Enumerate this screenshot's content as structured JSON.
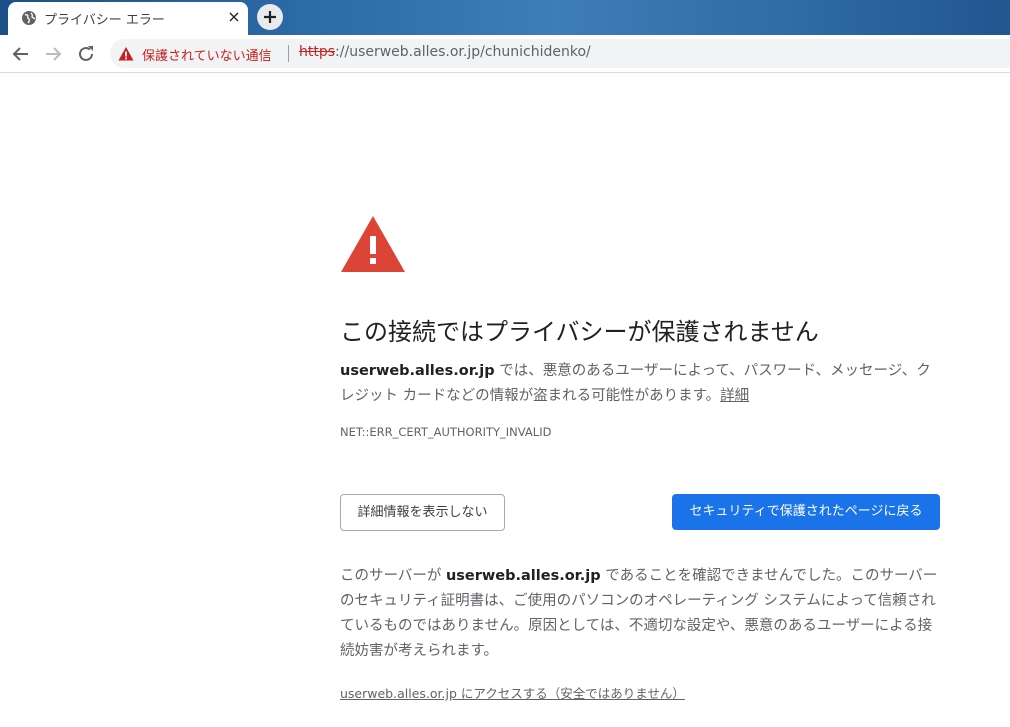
{
  "tab": {
    "title": "プライバシー エラー",
    "close_glyph": "×",
    "icon": "globe-icon"
  },
  "toolbar": {
    "back_icon": "back-arrow-icon",
    "forward_icon": "forward-arrow-icon",
    "reload_icon": "reload-icon",
    "security_label": "保護されていない通信",
    "url_scheme": "https",
    "url_rest": "://userweb.alles.or.jp/chunichidenko/"
  },
  "main": {
    "heading": "この接続ではプライバシーが保護されません",
    "explanation_host": "userweb.alles.or.jp",
    "explanation_text": " では、悪意のあるユーザーによって、パスワード、メッセージ、クレジット カードなどの情報が盗まれる可能性があります。",
    "details_link": "詳細",
    "error_code": "NET::ERR_CERT_AUTHORITY_INVALID",
    "hide_details_button": "詳細情報を表示しない",
    "back_to_safety_button": "セキュリティで保護されたページに戻る",
    "details_prefix": "このサーバーが ",
    "details_host": "userweb.alles.or.jp",
    "details_suffix": " であることを確認できませんでした。このサーバーのセキュリティ証明書は、ご使用のパソコンのオペレーティング システムによって信頼されているものではありません。原因としては、不適切な設定や、悪意のあるユーザーによる接続妨害が考えられます。",
    "proceed_link": "userweb.alles.or.jp にアクセスする（安全ではありません）"
  },
  "colors": {
    "accent": "#1a73e8",
    "danger": "#c5221f",
    "warning_triangle": "#db4437"
  }
}
